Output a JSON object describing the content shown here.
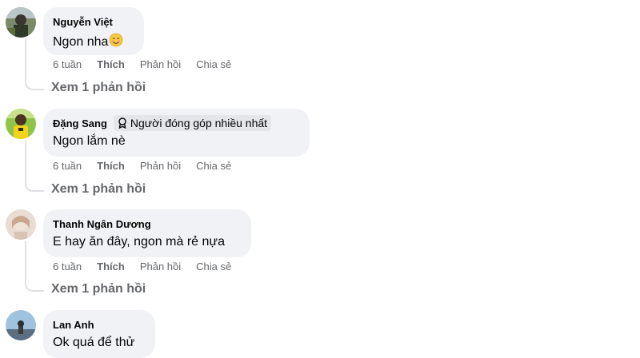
{
  "comments": [
    {
      "author": "Nguyễn Việt",
      "text": "Ngon nha",
      "emoji": "smiling-face-emoji",
      "time": "6 tuần",
      "like": "Thích",
      "reply": "Phản hồi",
      "share": "Chia sẻ",
      "view_replies": "Xem 1 phản hồi"
    },
    {
      "author": "Đặng Sang",
      "badge": "Người đóng góp nhiều nhất",
      "text": "Ngon lắm nè",
      "time": "6 tuần",
      "like": "Thích",
      "reply": "Phản hồi",
      "share": "Chia sẻ",
      "view_replies": "Xem 1 phản hồi"
    },
    {
      "author": "Thanh Ngân Dương",
      "text": "E hay ăn đây, ngon mà rẻ nựa",
      "time": "6 tuần",
      "like": "Thích",
      "reply": "Phản hồi",
      "share": "Chia sẻ",
      "view_replies": "Xem 1 phản hồi"
    },
    {
      "author": "Lan Anh",
      "text": "Ok quá để thử"
    }
  ],
  "colors": {
    "bubble": "#f0f2f5",
    "meta_text": "#65676b",
    "primary_text": "#050505",
    "thread_line": "#dfe1e5"
  }
}
